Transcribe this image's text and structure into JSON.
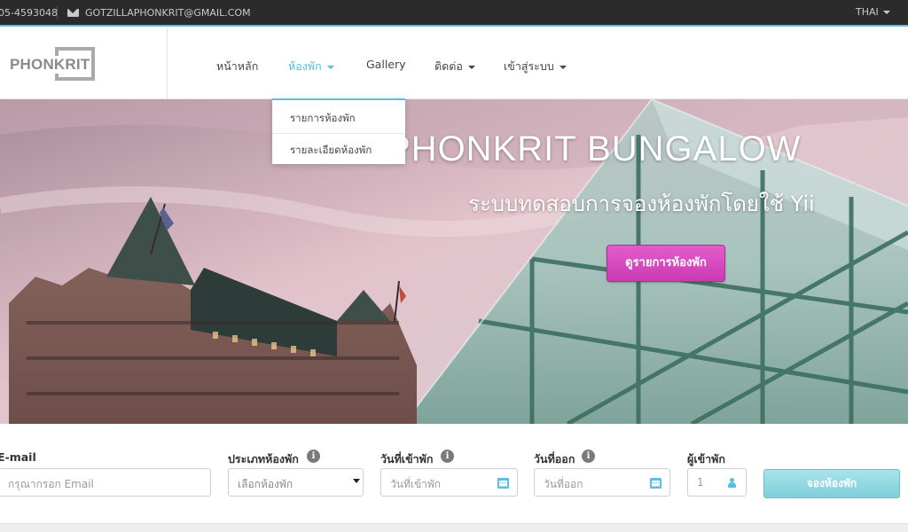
{
  "topbar": {
    "phone": "05-4593048",
    "email": "GOTZILLAPHONKRIT@GMAIL.COM",
    "language": "THAI"
  },
  "brand": {
    "logo_text": "PHONKRIT"
  },
  "nav": {
    "items": [
      {
        "label": "หน้าหลัก"
      },
      {
        "label": "ห้องพัก"
      },
      {
        "label": "Gallery"
      },
      {
        "label": "ติดต่อ"
      },
      {
        "label": "เข้าสู่ระบบ"
      }
    ],
    "active_index": 1
  },
  "dropdown": {
    "items": [
      {
        "label": "รายการห้องพัก"
      },
      {
        "label": "รายละเอียดห้องพัก"
      }
    ]
  },
  "hero": {
    "title": "PHONKRIT BUNGALOW",
    "subtitle": "ระบบทดสอบการจองห้องพักโดยใช้ Yii",
    "button_label": "ดูรายการห้องพัก"
  },
  "booking": {
    "email_label": "E-mail",
    "email_placeholder": "กรุณากรอก Email",
    "room_type_label": "ประเภทห้องพัก",
    "room_type_selected": "เลือกห้องพัก",
    "checkin_label": "วันที่เข้าพัก",
    "checkin_placeholder": "วันที่เข้าพัก",
    "checkout_label": "วันที่ออก",
    "checkout_placeholder": "วันที่ออก",
    "guests_label": "ผู้เข้าพัก",
    "guests_value": "1",
    "submit_label": "จองห้องพัก"
  },
  "icons": {
    "mail": "mail-icon",
    "info": "info-icon",
    "calendar": "calendar-icon",
    "person": "person-icon"
  },
  "colors": {
    "accent": "#5bc0de",
    "hero_button": "#d84bbf",
    "topbar": "#2b2b2b"
  }
}
